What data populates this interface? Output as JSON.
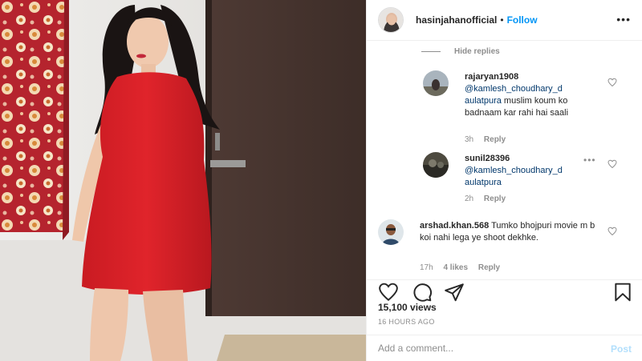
{
  "header": {
    "username": "hasinjahanofficial",
    "separator": "•",
    "follow_label": "Follow",
    "more_icon": "more-horizontal-icon"
  },
  "comments": {
    "hide_replies_label": "Hide replies",
    "replies": [
      {
        "username": "rajaryan1908",
        "mention": "@kamlesh_choudhary_d aulatpura",
        "text": " muslim koum ko badnaam kar rahi hai saali",
        "time": "3h",
        "reply_label": "Reply"
      },
      {
        "username": "sunil28396",
        "mention": "@kamlesh_choudhary_d aulatpura",
        "text": "",
        "time": "2h",
        "reply_label": "Reply"
      }
    ],
    "main_comment": {
      "username": "arshad.khan.568",
      "text": "Tumko bhojpuri movie m b koi nahi lega ye shoot dekhke.",
      "time": "17h",
      "likes": "4 likes",
      "reply_label": "Reply"
    }
  },
  "actions": {
    "icons": [
      "heart-icon",
      "comment-icon",
      "share-icon",
      "bookmark-icon"
    ],
    "views": "15,100 views",
    "time_ago": "16 HOURS AGO"
  },
  "add_comment": {
    "placeholder": "Add a comment...",
    "post_label": "Post"
  },
  "colors": {
    "accent": "#0095f6",
    "post_disabled": "#b2dffc",
    "dress": "#e0242b"
  }
}
